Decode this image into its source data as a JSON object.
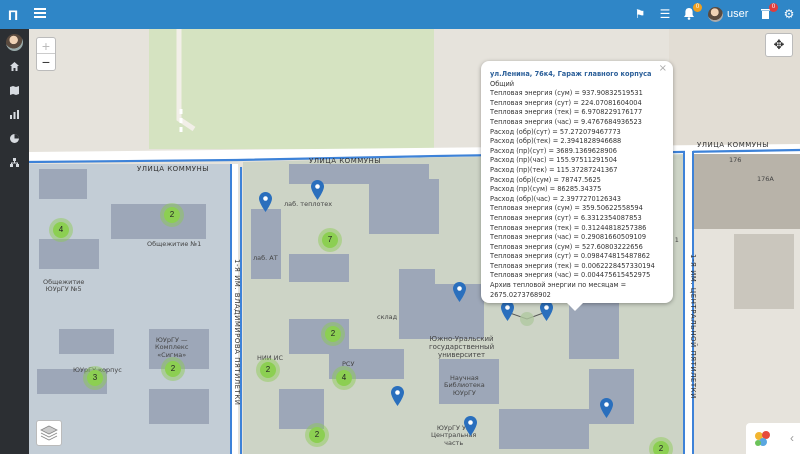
{
  "app": {
    "brand": "П",
    "user": "user"
  },
  "topbar": {
    "icons": [
      {
        "name": "flag-icon",
        "glyph": "⚑"
      },
      {
        "name": "list-icon",
        "glyph": "☰"
      },
      {
        "name": "bell-icon",
        "glyph": "🔔",
        "badge": "0",
        "badge_color": "#f0a020"
      },
      {
        "name": "trash-icon",
        "glyph": "🗑",
        "badge": "0",
        "badge_color": "#e03c3c"
      },
      {
        "name": "gears-icon",
        "glyph": "⚙"
      }
    ]
  },
  "sidebar": {
    "items": [
      {
        "name": "home-icon",
        "glyph": "⌂"
      },
      {
        "name": "map-icon",
        "glyph": "▥"
      },
      {
        "name": "chart-icon",
        "glyph": "▮"
      },
      {
        "name": "pie-icon",
        "glyph": "◔"
      },
      {
        "name": "org-icon",
        "glyph": "⊥"
      }
    ]
  },
  "map": {
    "zoom_in": "+",
    "zoom_out": "−",
    "streets": {
      "north_left": "УЛИЦА КОММУНЫ",
      "north_center": "УЛИЦА КОММУНЫ",
      "north_right": "УЛИЦА КОММУНЫ",
      "west": "1-Я ИМ. ВЛАДИМИРОВА ПЯТИЛЕТКИ",
      "east": "1-Я ИМ. ЦЕНТРАЛЬНОЙ ПЯТИЛЕТКИ"
    },
    "places": {
      "lab_teplotech": "лаб. теплотех",
      "obshchezhitie": "Общежитие №1",
      "obshchezhitie5": "Общежитие\nЮУрГУ №5",
      "lab_at": "лаб. АТ",
      "sklad": "склад",
      "university": "Южно-Уральский\nгосударственный\nуниверситет",
      "library": "Научная\nБиблиотека\nЮУрГУ",
      "complex": "ЮУрГУ —\nКомплекс\n«Сигма»",
      "korpus": "ЮУрГУ корпус",
      "korpus1": "корпус 1",
      "rsu": "РСУ",
      "nii": "НИИ ИС",
      "central": "ЮУрГУ УХ\nЦентральная\nчасть",
      "n176": "176",
      "n176a": "176А"
    },
    "clusters": [
      {
        "count": "2"
      },
      {
        "count": "4"
      },
      {
        "count": "7"
      },
      {
        "count": "2"
      },
      {
        "count": "3"
      },
      {
        "count": "2"
      },
      {
        "count": "2"
      },
      {
        "count": "4"
      },
      {
        "count": "2"
      },
      {
        "count": "2"
      },
      {
        "count": "2"
      }
    ]
  },
  "popup": {
    "close": "×",
    "title": "ул.Ленина, 76к4, Гараж главного корпуса",
    "subtitle": "Общий",
    "lines": [
      "Тепловая энергия (сум) = 937.90832519531",
      "Тепловая энергия (сут) = 224.07081604004",
      "Тепловая энергия (тек) = 6.9708229176177",
      "Тепловая энергия (час) = 9.4767684936523",
      "Расход (обр)(сут) = 57.272079467773",
      "Расход (обр)(тек) = 2.3941828946688",
      "Расход (пр)(сут) = 3689.1369628906",
      "Расход (пр)(час) = 155.97511291504",
      "Расход (пр)(тек) = 115.37287241367",
      "Расход (обр)(сум) = 78747.5625",
      "Расход (пр)(сум) = 86285.34375",
      "Расход (обр)(час) = 2.3977270126343",
      "Тепловая энергия (сум) = 359.50622558594",
      "Тепловая энергия (сут) = 6.3312354087853",
      "Тепловая энергия (тек) = 0.31244818257386",
      "Тепловая энергия (час) = 0.29081660509109",
      "Тепловая энергия (сум) = 527.60803222656",
      "Тепловая энергия (сут) = 0.098474815487862",
      "Тепловая энергия (тек) = 0.0062228457330194",
      "Тепловая энергия (час) = 0.004475615452975",
      "Архив тепловой энергии по месяцам = 2675.0273768902"
    ]
  }
}
